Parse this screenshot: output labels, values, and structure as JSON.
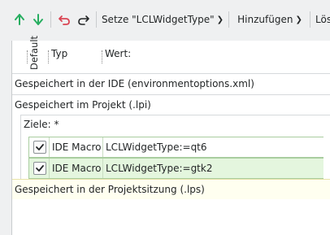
{
  "toolbar": {
    "up_icon": "arrow-up-icon",
    "down_icon": "arrow-down-icon",
    "undo_icon": "undo-icon",
    "redo_icon": "redo-icon",
    "set_type_label": "Setze \"LCLWidgetType\"",
    "add_label": "Hinzufügen",
    "delete_label": "Lös"
  },
  "header": {
    "default_label": "Default",
    "type_label": "Typ",
    "value_label": "Wert:"
  },
  "sections": {
    "ide": "Gespeichert in der IDE (environmentoptions.xml)",
    "project": "Gespeichert im Projekt (.lpi)",
    "session": "Gespeichert in der Projektsitzung (.lps)"
  },
  "goals": {
    "label": "Ziele: *",
    "rows": [
      {
        "checked": true,
        "type": "IDE Macro",
        "value": "LCLWidgetType:=qt6"
      },
      {
        "checked": true,
        "type": "IDE Macro",
        "value": "LCLWidgetType:=gtk2"
      }
    ]
  },
  "colors": {
    "arrow_green": "#27ae60",
    "undo_red": "#da4453",
    "row_highlight": "#e4f6de",
    "session_bg": "#fffff0"
  }
}
